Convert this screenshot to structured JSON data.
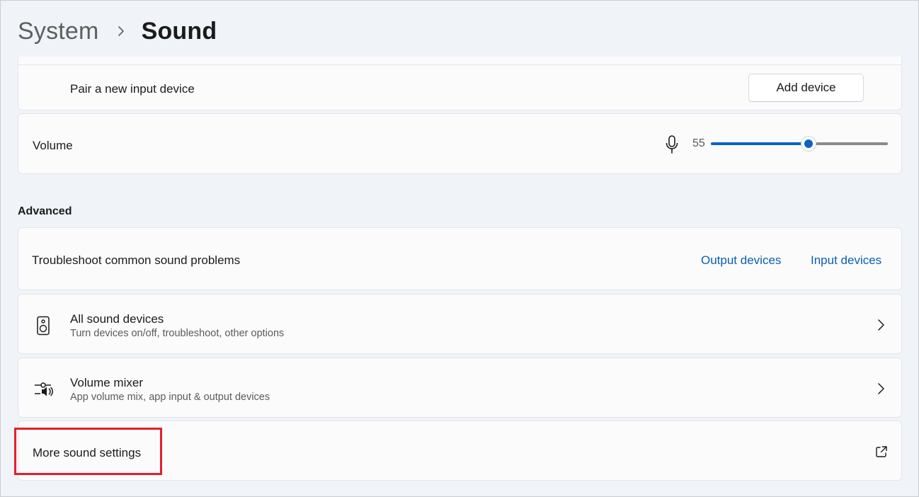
{
  "breadcrumb": {
    "parent": "System",
    "current": "Sound"
  },
  "input": {
    "pair_label": "Pair a new input device",
    "add_button": "Add device",
    "volume_label": "Volume",
    "volume_value": "55",
    "volume_level": 55
  },
  "advanced": {
    "title": "Advanced",
    "troubleshoot": {
      "label": "Troubleshoot common sound problems",
      "output_link": "Output devices",
      "input_link": "Input devices"
    },
    "all_devices": {
      "title": "All sound devices",
      "subtitle": "Turn devices on/off, troubleshoot, other options"
    },
    "mixer": {
      "title": "Volume mixer",
      "subtitle": "App volume mix, app input & output devices"
    },
    "more": {
      "label": "More sound settings"
    }
  },
  "colors": {
    "accent": "#0a64c4",
    "link": "#0a5fb0",
    "highlight": "#e2202c",
    "background": "#f0f3f8"
  },
  "icons": {
    "chevron": "chevron-right-icon",
    "mic": "microphone-icon",
    "speaker": "speaker-icon",
    "mixer": "volume-mixer-icon",
    "external": "open-external-icon"
  }
}
